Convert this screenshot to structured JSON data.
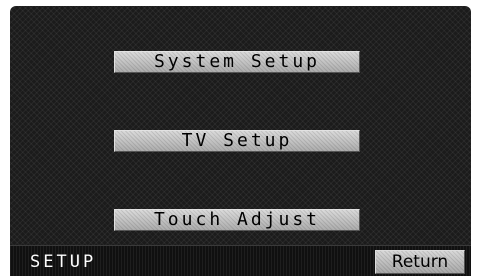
{
  "menu": {
    "items": [
      {
        "label": "System Setup"
      },
      {
        "label": "TV Setup"
      },
      {
        "label": "Touch Adjust"
      }
    ]
  },
  "status_bar": {
    "title": "SETUP",
    "return_label": "Return"
  },
  "colors": {
    "screen_background": "#1b1b1b",
    "button_face": "#c4c4c4",
    "status_bar_background": "#101010",
    "status_text": "#ffffff"
  }
}
